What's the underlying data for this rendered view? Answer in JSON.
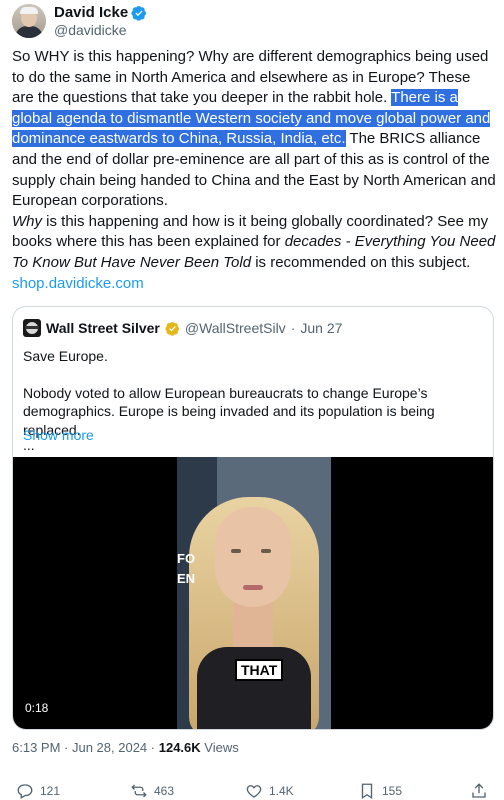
{
  "author": {
    "name": "David Icke",
    "handle": "@davidicke"
  },
  "post": {
    "p1": "So WHY is this happening? Why are different demographics being used to do the same in North America and elsewhere as in Europe? These are the questions that take you deeper in the rabbit hole. ",
    "highlight": "There is a global agenda to dismantle Western society and move global power and dominance eastwards to China, Russia, India, etc.",
    "p2": " The BRICS alliance and the end of dollar pre-eminence are all part of this as is control of the supply chain being handed to China and the East by North American and European corporations.",
    "why": "Why",
    "p3": " is this happening and how is it being globally coordinated? See my books where this has been explained for ",
    "decades": "decades - Everything You Need To Know But Have Never Been Told",
    "p4": " is recommended on this subject.",
    "link": "shop.davidicke.com"
  },
  "quote": {
    "name": "Wall Street Silver",
    "handle": "@WallStreetSilv",
    "sep": "·",
    "date": "Jun 27",
    "line1": "Save Europe.",
    "line2": "Nobody voted to allow European bureaucrats to change Europe’s demographics. Europe is being invaded and its population is being replaced.",
    "ellipsis": "...",
    "show_more": "Show more",
    "video": {
      "duration": "0:18",
      "caption": "THAT",
      "side_text": "FO\nEN"
    }
  },
  "meta": {
    "time": "6:13 PM",
    "date": "Jun 28, 2024",
    "views": "124.6K",
    "views_label": "Views"
  },
  "actions": {
    "replies": "121",
    "reposts": "463",
    "likes": "1.4K",
    "bookmarks": "155"
  },
  "colors": {
    "accent": "#1d9bf0",
    "highlight_bg": "#2f6fe0",
    "muted": "#536471",
    "gold_badge": "#e2b719"
  }
}
